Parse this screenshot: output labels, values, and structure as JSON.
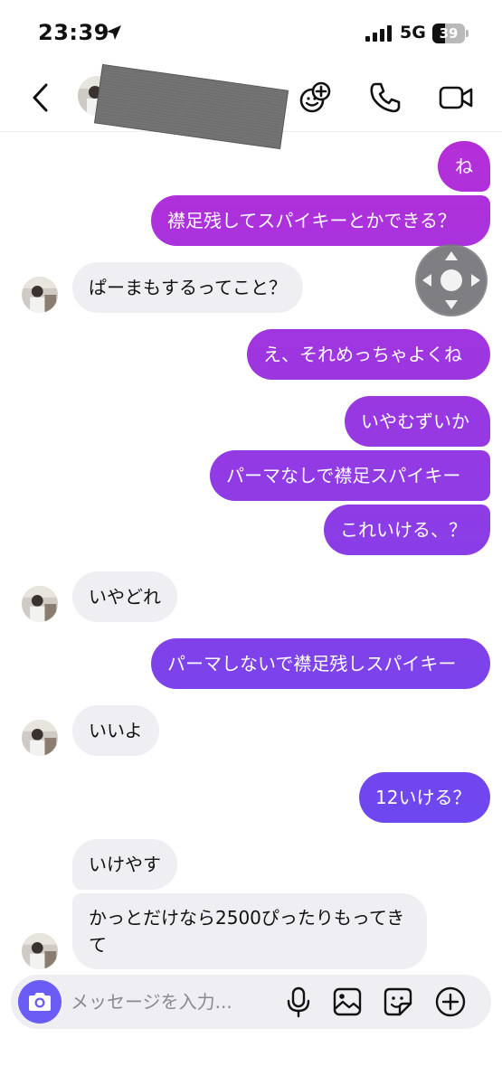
{
  "status_bar": {
    "time": "23:39",
    "network": "5G",
    "battery": "39",
    "battery_level": 0.39
  },
  "header": {
    "back_icon": "chevron-left-icon",
    "effects_icon": "add-effect-face-icon",
    "call_icon": "phone-icon",
    "video_icon": "video-camera-icon"
  },
  "colors": {
    "bubble_gradient_top": "#b52ed8",
    "bubble_gradient_bottom": "#5e4df5",
    "incoming_bubble": "#efeff3",
    "camera_button": "#6a5cf5"
  },
  "messages": [
    {
      "direction": "out",
      "text": "ね"
    },
    {
      "direction": "out",
      "text": "襟足残してスパイキーとかできる？"
    },
    {
      "direction": "in",
      "text": "ぱーまもするってこと？"
    },
    {
      "direction": "out",
      "text": "え、それめっちゃよくね"
    },
    {
      "direction": "out",
      "text": "いやむずいか"
    },
    {
      "direction": "out",
      "text": "パーマなしで襟足スパイキー"
    },
    {
      "direction": "out",
      "text": "これいける、？"
    },
    {
      "direction": "in",
      "text": "いやどれ"
    },
    {
      "direction": "out",
      "text": "パーマしないで襟足残しスパイキー"
    },
    {
      "direction": "in",
      "text": "いいよ"
    },
    {
      "direction": "out",
      "text": "12いける？"
    },
    {
      "direction": "in",
      "text": "いけやす"
    },
    {
      "direction": "in",
      "text": "かっとだけなら2500ぴったりもってきて"
    }
  ],
  "composer": {
    "placeholder": "メッセージを入力...",
    "camera_icon": "camera-icon",
    "mic_icon": "microphone-icon",
    "gallery_icon": "image-icon",
    "sticker_icon": "sticker-icon",
    "add_icon": "plus-circle-icon"
  },
  "overlay": {
    "joystick_icon": "assistive-touch-dpad-icon"
  }
}
